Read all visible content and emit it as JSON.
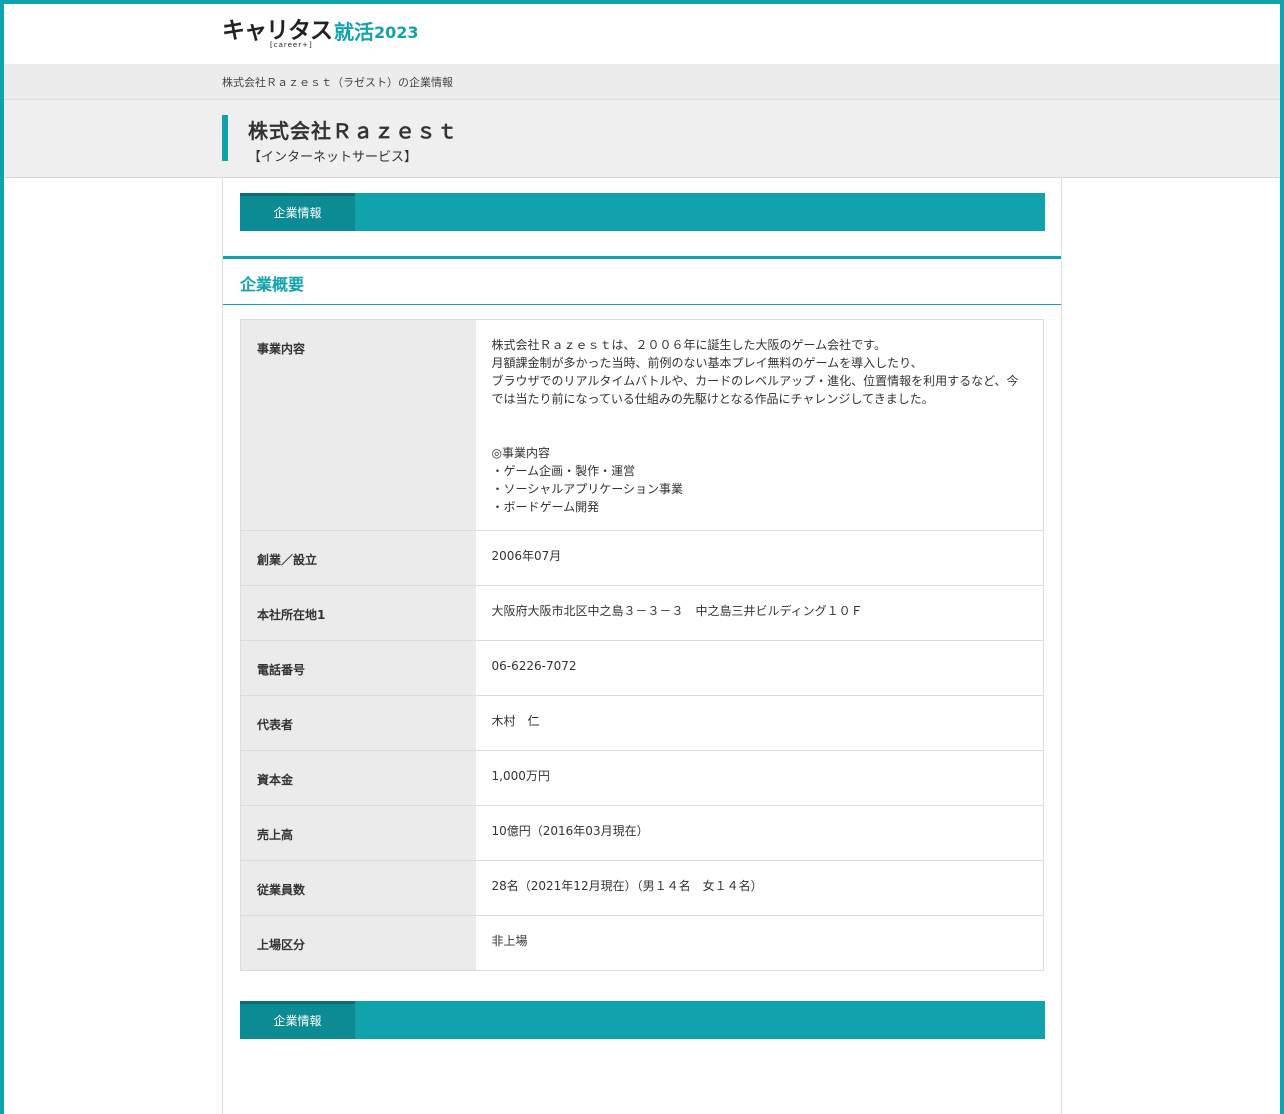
{
  "header": {
    "logo_main": "キャリタス",
    "logo_sub": "[career+]",
    "logo_accent": "就活",
    "logo_year": "2023"
  },
  "breadcrumb": "株式会社Ｒａｚｅｓｔ（ラゼスト）の企業情報",
  "company": {
    "name": "株式会社Ｒａｚｅｓｔ",
    "industry": "【インターネットサービス】"
  },
  "tabs": {
    "top_label": "企業情報",
    "bottom_label": "企業情報"
  },
  "section": {
    "title": "企業概要"
  },
  "rows": [
    {
      "label": "事業内容",
      "value": "株式会社Ｒａｚｅｓｔは、２００６年に誕生した大阪のゲーム会社です。\n月額課金制が多かった当時、前例のない基本プレイ無料のゲームを導入したり、\nブラウザでのリアルタイムバトルや、カードのレベルアップ・進化、位置情報を利用するなど、今では当たり前になっている仕組みの先駆けとなる作品にチャレンジしてきました。\n\n\n◎事業内容\n・ゲーム企画・製作・運営\n・ソーシャルアプリケーション事業\n・ボードゲーム開発"
    },
    {
      "label": "創業／設立",
      "value": "2006年07月"
    },
    {
      "label": "本社所在地1",
      "value": "大阪府大阪市北区中之島３－３－３　中之島三井ビルディング１０Ｆ"
    },
    {
      "label": "電話番号",
      "value": "06-6226-7072"
    },
    {
      "label": "代表者",
      "value": "木村　仁"
    },
    {
      "label": "資本金",
      "value": "1,000万円"
    },
    {
      "label": "売上高",
      "value": "10億円（2016年03月現在）"
    },
    {
      "label": "従業員数",
      "value": "28名（2021年12月現在）（男１４名　女１４名）"
    },
    {
      "label": "上場区分",
      "value": "非上場"
    }
  ],
  "colors": {
    "accent": "#11a3ad",
    "tab_active": "#0d8b94",
    "label_bg": "#ebebeb"
  }
}
